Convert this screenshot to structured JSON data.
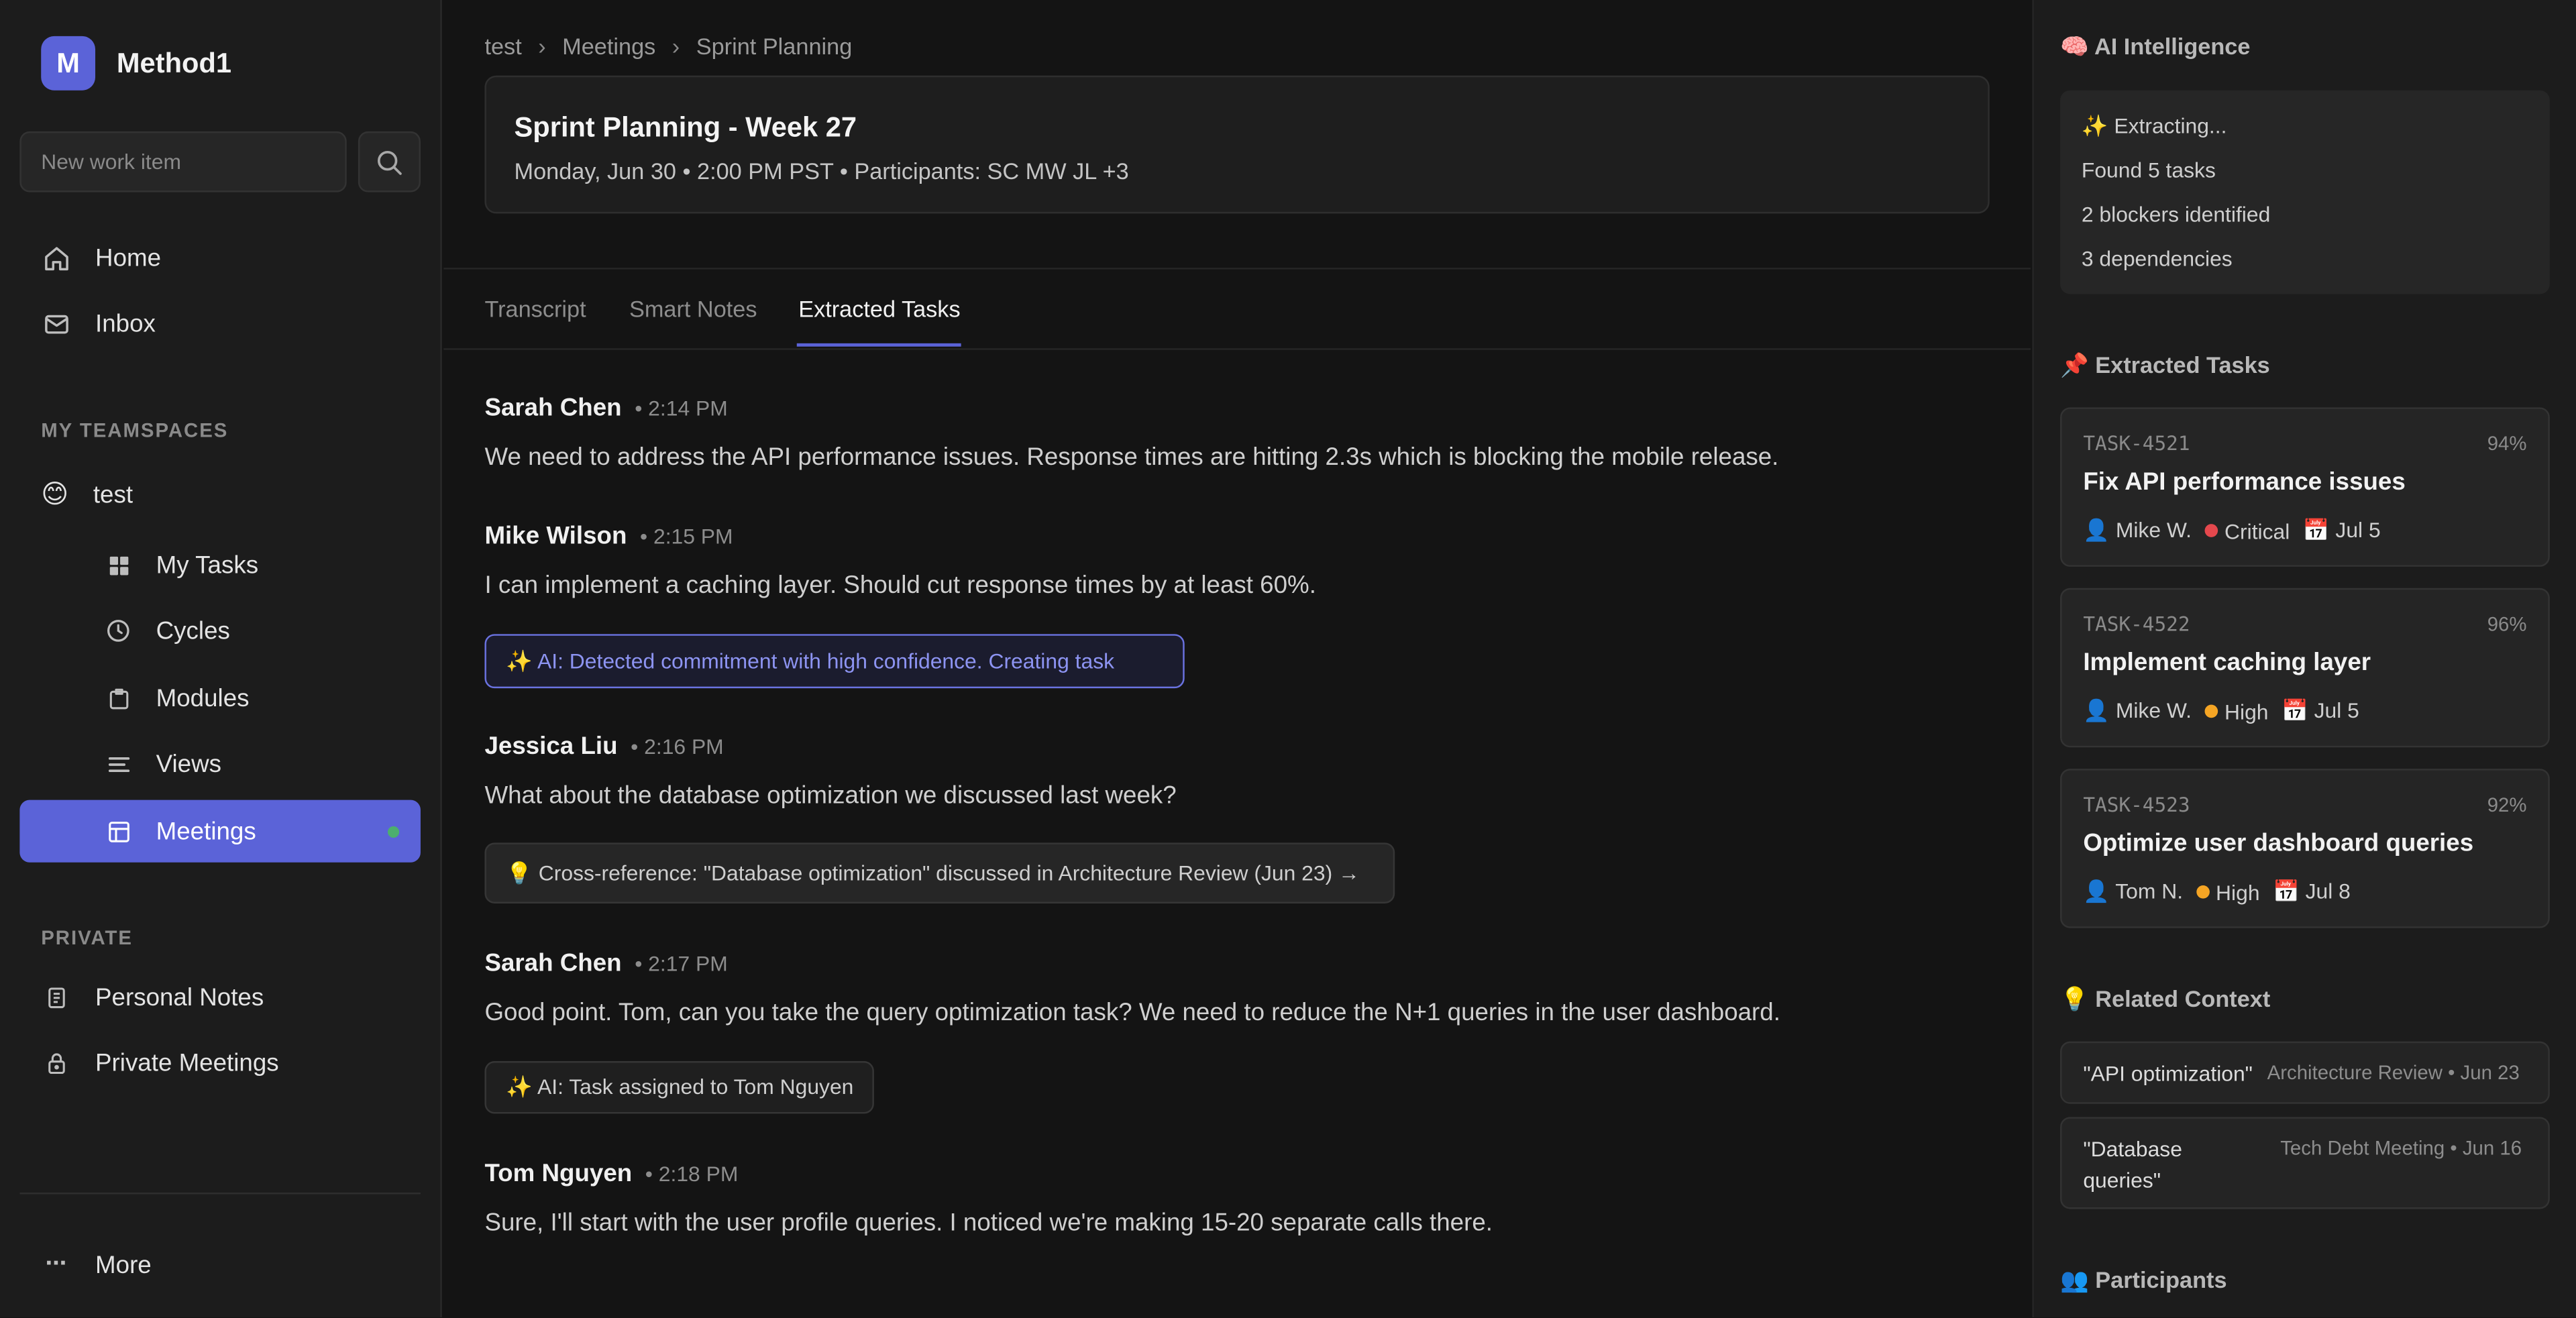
{
  "sidebar": {
    "brand_letter": "M",
    "brand_name": "Method1",
    "new_item_placeholder": "New work item",
    "nav": [
      {
        "label": "Home",
        "icon": "home-icon"
      },
      {
        "label": "Inbox",
        "icon": "mail-icon"
      }
    ],
    "teamspaces_label": "MY TEAMSPACES",
    "teamspace": {
      "emoji": "😊",
      "name": "test"
    },
    "team_items": [
      {
        "label": "My Tasks",
        "icon": "grid-icon"
      },
      {
        "label": "Cycles",
        "icon": "cycle-icon"
      },
      {
        "label": "Modules",
        "icon": "module-icon"
      },
      {
        "label": "Views",
        "icon": "views-icon"
      },
      {
        "label": "Meetings",
        "icon": "meeting-icon",
        "active": true
      }
    ],
    "private_label": "PRIVATE",
    "private_items": [
      {
        "label": "Personal Notes",
        "icon": "notes-icon"
      },
      {
        "label": "Private Meetings",
        "icon": "lock-icon"
      }
    ],
    "more": {
      "glyph": "···",
      "label": "More"
    }
  },
  "breadcrumb": {
    "items": [
      "test",
      "Meetings",
      "Sprint Planning"
    ],
    "separator": "›"
  },
  "meeting": {
    "title": "Sprint Planning - Week 27",
    "meta": "Monday, Jun 30 • 2:00 PM PST • Participants: SC MW JL +3"
  },
  "tabs": [
    "Transcript",
    "Smart Notes",
    "Extracted Tasks"
  ],
  "transcript": [
    {
      "speaker": "Sarah Chen",
      "time": "• 2:14 PM",
      "text": "We need to address the API performance issues. Response times are hitting 2.3s which is blocking the mobile release."
    },
    {
      "speaker": "Mike Wilson",
      "time": "• 2:15 PM",
      "text": "I can implement a caching layer. Should cut response times by at least 60%."
    },
    {
      "speaker": "Jessica Liu",
      "time": "• 2:16 PM",
      "text": "What about the database optimization we discussed last week?"
    },
    {
      "speaker": "Sarah Chen",
      "time": "• 2:17 PM",
      "text": "Good point. Tom, can you take the query optimization task? We need to reduce the N+1 queries in the user dashboard."
    },
    {
      "speaker": "Tom Nguyen",
      "time": "• 2:18 PM",
      "text": "Sure, I'll start with the user profile queries. I noticed we're making 15-20 separate calls there."
    }
  ],
  "ai_chips": {
    "commitment": "✨ AI: Detected commitment with high confidence. Creating task",
    "cross_reference": "💡 Cross-reference: \"Database optimization\" discussed in Architecture Review (Jun 23) →",
    "assigned": "✨ AI: Task assigned to Tom Nguyen"
  },
  "panel": {
    "intel_title": "🧠 AI Intelligence",
    "intel_lines": [
      "✨ Extracting...",
      "Found 5 tasks",
      "2 blockers identified",
      "3 dependencies"
    ],
    "tasks_title": "📌 Extracted Tasks",
    "tasks": [
      {
        "id": "TASK-4521",
        "confidence": "94%",
        "title": "Fix API performance issues",
        "assignee": "👤 Mike W.",
        "priority": "Critical",
        "priority_color": "#e5484d",
        "due": "📅 Jul 5"
      },
      {
        "id": "TASK-4522",
        "confidence": "96%",
        "title": "Implement caching layer",
        "assignee": "👤 Mike W.",
        "priority": "High",
        "priority_color": "#f5a524",
        "due": "📅 Jul 5"
      },
      {
        "id": "TASK-4523",
        "confidence": "92%",
        "title": "Optimize user dashboard queries",
        "assignee": "👤 Tom N.",
        "priority": "High",
        "priority_color": "#f5a524",
        "due": "📅 Jul 8"
      }
    ],
    "context_title": "💡 Related Context",
    "context": [
      {
        "quote": "\"API optimization\"",
        "source": "Architecture Review • Jun 23"
      },
      {
        "quote": "\"Database queries\"",
        "source": "Tech Debt Meeting • Jun 16"
      }
    ],
    "participants_title": "👥 Participants"
  },
  "colors": {
    "accent": "#5b63d8",
    "online": "#4caf6e",
    "critical": "#e5484d",
    "high": "#f5a524"
  }
}
